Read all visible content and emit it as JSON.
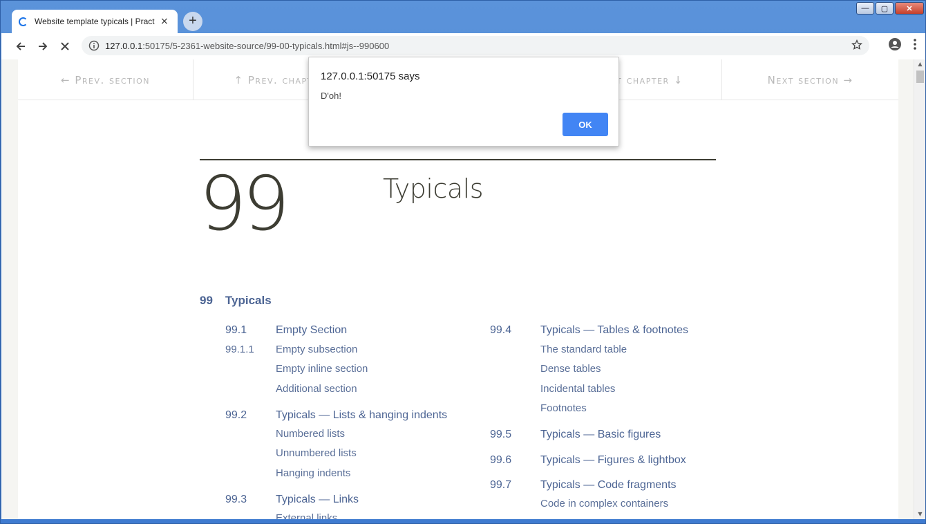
{
  "browser": {
    "tab_title": "Website template typicals | Practical",
    "tab_close": "×",
    "newtab_label": "+",
    "url_host": "127.0.0.1",
    "url_rest": ":50175/5-2361-website-source/99-00-typicals.html#js--990600",
    "window_buttons": {
      "minimize": "—",
      "maximize": "▢",
      "close": "✕"
    }
  },
  "secnav": {
    "prev_section": "← Prev. section",
    "prev_chapter": "↑ Prev. chapter",
    "next_chapter": "Next chapter ↓",
    "next_section": "Next section →"
  },
  "chapter": {
    "number": "99",
    "title": "Typicals"
  },
  "toc": {
    "top": {
      "num": "99",
      "title": "Typicals"
    },
    "left": [
      {
        "num": "99.1",
        "title": "Empty Section",
        "sub": false
      },
      {
        "num": "99.1.1",
        "title": "Empty subsection",
        "sub": true
      },
      {
        "num": "",
        "title": "Empty inline section",
        "sub": true
      },
      {
        "num": "",
        "title": "Additional section",
        "sub": true
      },
      {
        "num": "99.2",
        "title": "Typicals — Lists & hanging indents",
        "sub": false
      },
      {
        "num": "",
        "title": "Numbered lists",
        "sub": true
      },
      {
        "num": "",
        "title": "Unnumbered lists",
        "sub": true
      },
      {
        "num": "",
        "title": "Hanging indents",
        "sub": true
      },
      {
        "num": "99.3",
        "title": "Typicals — Links",
        "sub": false
      },
      {
        "num": "",
        "title": "External links",
        "sub": true
      }
    ],
    "right": [
      {
        "num": "99.4",
        "title": "Typicals — Tables & footnotes",
        "sub": false
      },
      {
        "num": "",
        "title": "The standard table",
        "sub": true
      },
      {
        "num": "",
        "title": "Dense tables",
        "sub": true
      },
      {
        "num": "",
        "title": "Incidental tables",
        "sub": true
      },
      {
        "num": "",
        "title": "Footnotes",
        "sub": true
      },
      {
        "num": "99.5",
        "title": "Typicals — Basic figures",
        "sub": false
      },
      {
        "num": "99.6",
        "title": "Typicals — Figures & lightbox",
        "sub": false
      },
      {
        "num": "99.7",
        "title": "Typicals — Code fragments",
        "sub": false
      },
      {
        "num": "",
        "title": "Code in complex containers",
        "sub": true
      }
    ]
  },
  "dialog": {
    "title": "127.0.0.1:50175 says",
    "message": "D'oh!",
    "ok": "OK"
  }
}
